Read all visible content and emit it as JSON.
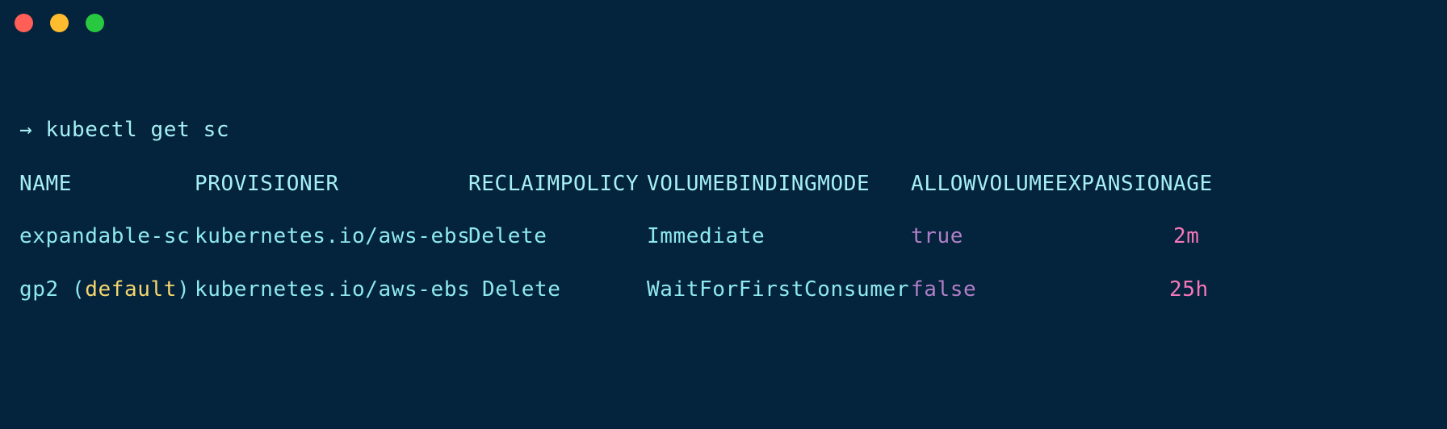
{
  "window": {
    "background_color": "#04233c",
    "controls": [
      {
        "name": "close",
        "color": "#ff5f57"
      },
      {
        "name": "minimize",
        "color": "#febc2e"
      },
      {
        "name": "maximize",
        "color": "#28c840"
      }
    ]
  },
  "colors": {
    "foreground": "#a6f0f5",
    "cyan": "#8ee9ef",
    "yellow": "#f5d76e",
    "purple": "#b07fc7",
    "pink": "#f877bb"
  },
  "prompt": {
    "symbol": "→",
    "command": "kubectl get sc"
  },
  "table": {
    "headers": {
      "name": "NAME",
      "provisioner": "PROVISIONER",
      "reclaimpolicy": "RECLAIMPOLICY",
      "volumebindingmode": "VOLUMEBINDINGMODE",
      "allowvolumeexpansion": "ALLOWVOLUMEEXPANSION",
      "age": "AGE"
    },
    "rows": [
      {
        "name": "expandable-sc",
        "name_suffix": "",
        "provisioner": "kubernetes.io/aws-ebs",
        "reclaimpolicy": "Delete",
        "volumebindingmode": "Immediate",
        "allowvolumeexpansion": "true",
        "age": "2m"
      },
      {
        "name": "gp2 (",
        "name_badge": "default",
        "name_suffix": ")",
        "provisioner": "kubernetes.io/aws-ebs",
        "reclaimpolicy": "Delete",
        "volumebindingmode": "WaitForFirstConsumer",
        "allowvolumeexpansion": "false",
        "age": "25h"
      }
    ]
  }
}
